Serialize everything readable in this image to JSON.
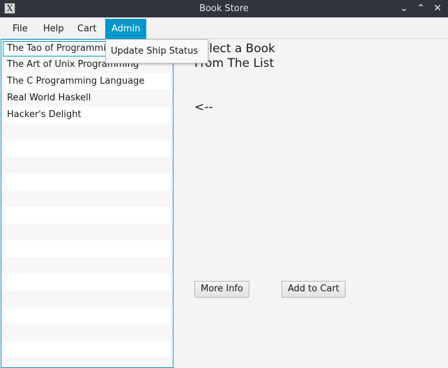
{
  "window": {
    "title": "Book Store",
    "app_icon_glyph": "X",
    "controls": {
      "minimize": "⌄",
      "maximize": "⌃",
      "close": "✕"
    }
  },
  "menubar": {
    "items": [
      {
        "label": "File"
      },
      {
        "label": "Help"
      },
      {
        "label": "Cart"
      },
      {
        "label": "Admin"
      }
    ]
  },
  "admin_menu": {
    "items": [
      {
        "label": "Update Ship Status"
      }
    ]
  },
  "books": [
    "The Tao of Programming",
    "The Art of Unix Programming",
    "The C Programming Language",
    "Real World Haskell",
    "Hacker's Delight"
  ],
  "detail": {
    "prompt": "Select a Book From The List",
    "arrow": "<--",
    "more_info_label": "More Info",
    "add_to_cart_label": "Add to Cart"
  },
  "colors": {
    "accent": "#0096c9",
    "titlebar": "#2f343f"
  }
}
